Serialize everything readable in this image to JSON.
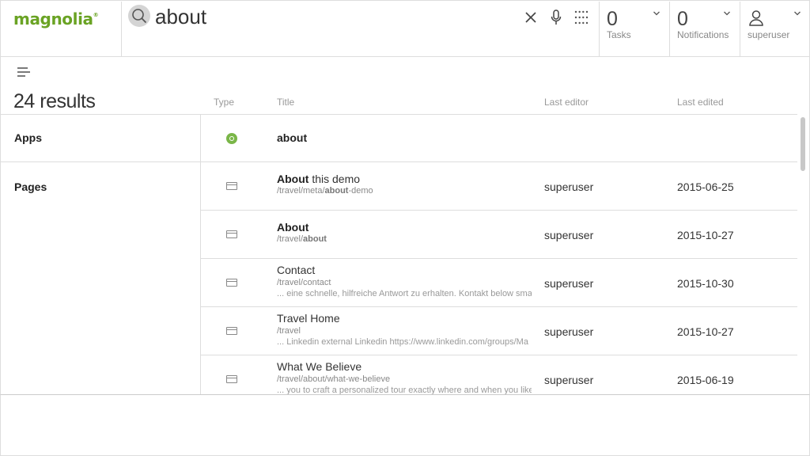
{
  "logo": {
    "text": "magnolia",
    "reg": "®"
  },
  "search": {
    "query": "about",
    "icon": "search-icon",
    "clear_icon": "close-icon",
    "mic_icon": "microphone-icon",
    "grid_icon": "app-launcher-grid-icon"
  },
  "tasks": {
    "count": "0",
    "label": "Tasks"
  },
  "notifications": {
    "count": "0",
    "label": "Notifications"
  },
  "user": {
    "name": "superuser"
  },
  "results": {
    "count_label": "24 results",
    "columns": {
      "type": "Type",
      "title": "Title",
      "last_editor": "Last editor",
      "last_edited": "Last edited"
    }
  },
  "groups": {
    "apps": {
      "label": "Apps",
      "items": [
        {
          "title_match": "about",
          "icon": "app-icon"
        }
      ]
    },
    "pages": {
      "label": "Pages",
      "items": [
        {
          "title_match": "About",
          "title_rest": " this demo",
          "path_pre": "/travel/meta/",
          "path_match": "about",
          "path_post": "-demo",
          "snippet": "",
          "editor": "superuser",
          "date": "2015-06-25",
          "icon": "page-icon"
        },
        {
          "title_match": "About",
          "title_rest": "",
          "path_pre": "/travel/",
          "path_match": "about",
          "path_post": "",
          "snippet": "",
          "editor": "superuser",
          "date": "2015-10-27",
          "icon": "page-icon"
        },
        {
          "title_match": "",
          "title_rest": "Contact",
          "path_pre": "/travel/contact",
          "path_match": "",
          "path_post": "",
          "snippet": "... eine schnelle, hilfreiche Antwort zu erhalten. Kontakt below sma",
          "editor": "superuser",
          "date": "2015-10-30",
          "icon": "page-icon"
        },
        {
          "title_match": "",
          "title_rest": "Travel Home",
          "path_pre": "/travel",
          "path_match": "",
          "path_post": "",
          "snippet": "... Linkedin external Linkedin https://www.linkedin.com/groups/Ma",
          "editor": "superuser",
          "date": "2015-10-27",
          "icon": "page-icon"
        },
        {
          "title_match": "",
          "title_rest": "What We Believe",
          "path_pre": "/travel/about/what-we-believe",
          "path_match": "",
          "path_post": "",
          "snippet": "... you to craft a personalized tour exactly where and when you like",
          "editor": "superuser",
          "date": "2015-06-19",
          "icon": "page-icon"
        }
      ]
    }
  },
  "colors": {
    "brand": "#6aa324",
    "app_icon": "#7ab648",
    "border": "#dddddd",
    "scrollbar": "#c8c8c8"
  }
}
